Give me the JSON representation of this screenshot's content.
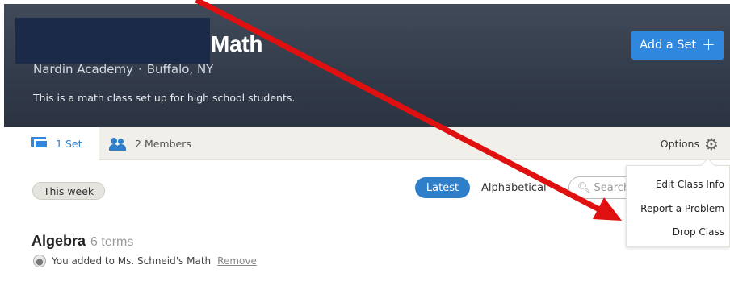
{
  "header": {
    "class_title": "Math",
    "school": "Nardin Academy",
    "location": "Buffalo, NY",
    "separator": "·",
    "description": "This is a math class set up for high school students.",
    "add_set_label": "Add a Set",
    "add_set_icon": "+"
  },
  "tabs": {
    "sets": {
      "count": "1",
      "label": "Set"
    },
    "members": {
      "count": "2",
      "label": "Members"
    },
    "options_label": "Options"
  },
  "filters": {
    "week_badge": "This week",
    "latest": "Latest",
    "alphabetical": "Alphabetical",
    "search_placeholder": "Search"
  },
  "set": {
    "name": "Algebra",
    "terms": "6 terms",
    "added_text": "You added to Ms. Schneid's Math",
    "remove_label": "Remove"
  },
  "options_menu": [
    "Edit Class Info",
    "Report a Problem",
    "Drop Class"
  ],
  "colors": {
    "accent": "#2f87de",
    "header_bg": "#363f4e",
    "annotation": "#e01010"
  }
}
